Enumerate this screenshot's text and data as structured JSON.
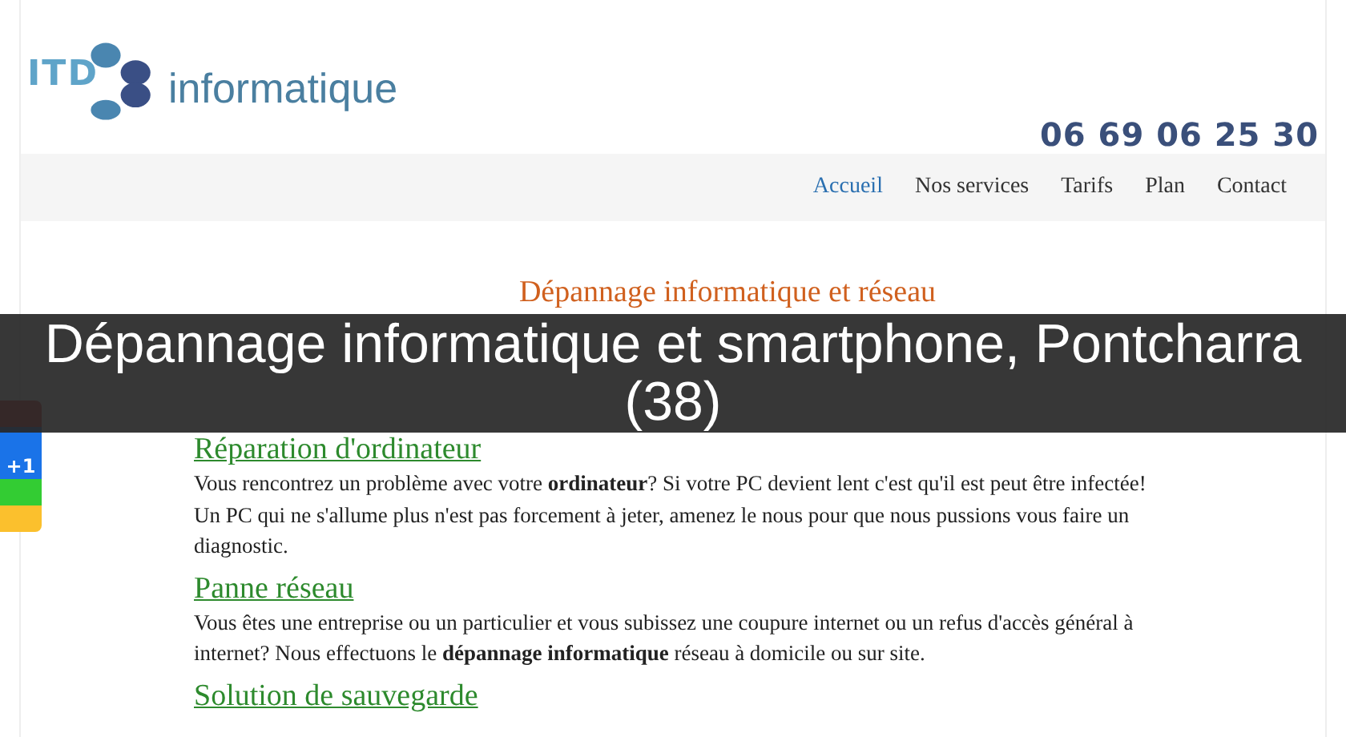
{
  "header": {
    "logo_letters": "ITD",
    "logo_word": "informatique",
    "phone": "06 69 06 25 30"
  },
  "nav": [
    {
      "label": "Accueil",
      "selected": true
    },
    {
      "label": "Nos services",
      "selected": false
    },
    {
      "label": "Tarifs",
      "selected": false
    },
    {
      "label": "Plan",
      "selected": false
    },
    {
      "label": "Contact",
      "selected": false
    }
  ],
  "page_title": "Dépannage informatique et réseau",
  "sections": [
    {
      "heading": "Réparation d'ordinateur",
      "paragraphs": [
        "Vous rencontrez un problème avec votre **ordinateur**? Si votre PC devient lent c'est qu'il est peut être infectée!",
        "Un PC qui ne s'allume plus n'est pas forcement à jeter, amenez le nous pour que nous pussions vous faire un diagnostic."
      ]
    },
    {
      "heading": "Panne réseau",
      "paragraphs": [
        "Vous êtes une entreprise ou un particulier et vous subissez une coupure internet ou un refus d'accès général à internet? Nous effectuons le **dépannage informatique** réseau à domicile ou sur site."
      ]
    },
    {
      "heading": "Solution de sauvegarde"
    }
  ],
  "share_button": {
    "label": "+1"
  },
  "caption": "Dépannage informatique et smartphone, Pontcharra (38)"
}
